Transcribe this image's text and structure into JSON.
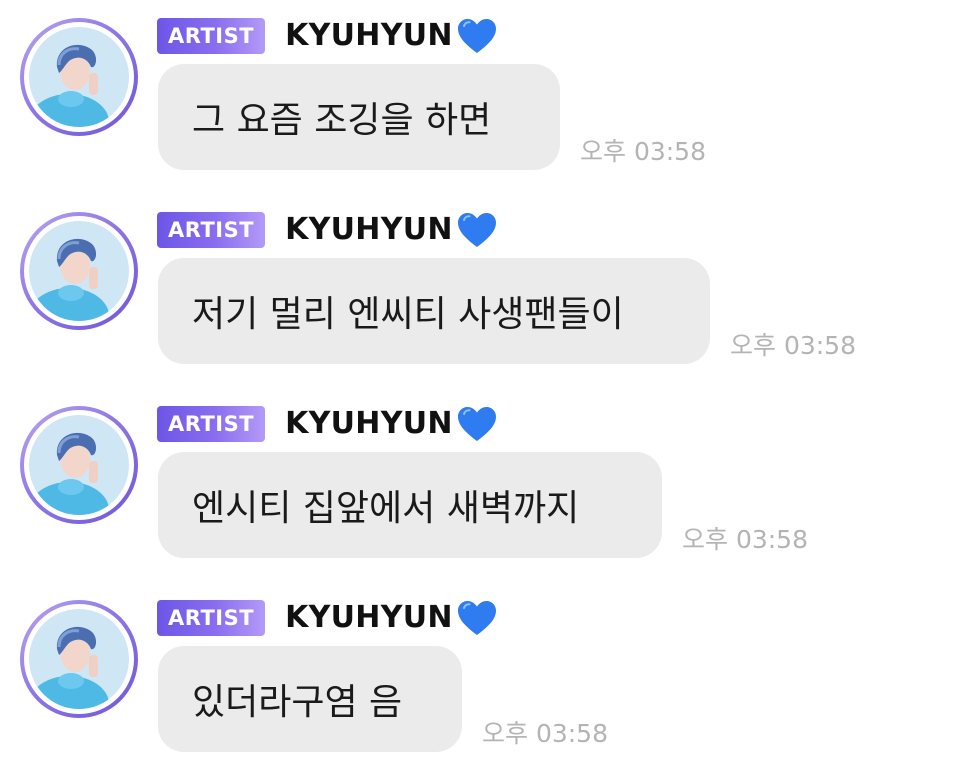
{
  "chat": {
    "messages": [
      {
        "badge": "ARTIST",
        "name": "KYUHYUN",
        "name_emoji": "blue-heart-icon",
        "text": "그 요즘 조깅을 하면",
        "time": "오후 03:58"
      },
      {
        "badge": "ARTIST",
        "name": "KYUHYUN",
        "name_emoji": "blue-heart-icon",
        "text": "저기 멀리 엔씨티 사생팬들이",
        "time": "오후 03:58"
      },
      {
        "badge": "ARTIST",
        "name": "KYUHYUN",
        "name_emoji": "blue-heart-icon",
        "text": "엔시티 집앞에서 새벽까지",
        "time": "오후 03:58"
      },
      {
        "badge": "ARTIST",
        "name": "KYUHYUN",
        "name_emoji": "blue-heart-icon",
        "text": "있더라구염 음",
        "time": "오후 03:58"
      }
    ]
  },
  "colors": {
    "badge_gradient_start": "#6d56e6",
    "badge_gradient_end": "#b49af7",
    "bubble_bg": "#ebebeb",
    "timestamp": "#b4b4b4",
    "heart": "#2f7cf0",
    "avatar_ring": "#8f77e8"
  }
}
